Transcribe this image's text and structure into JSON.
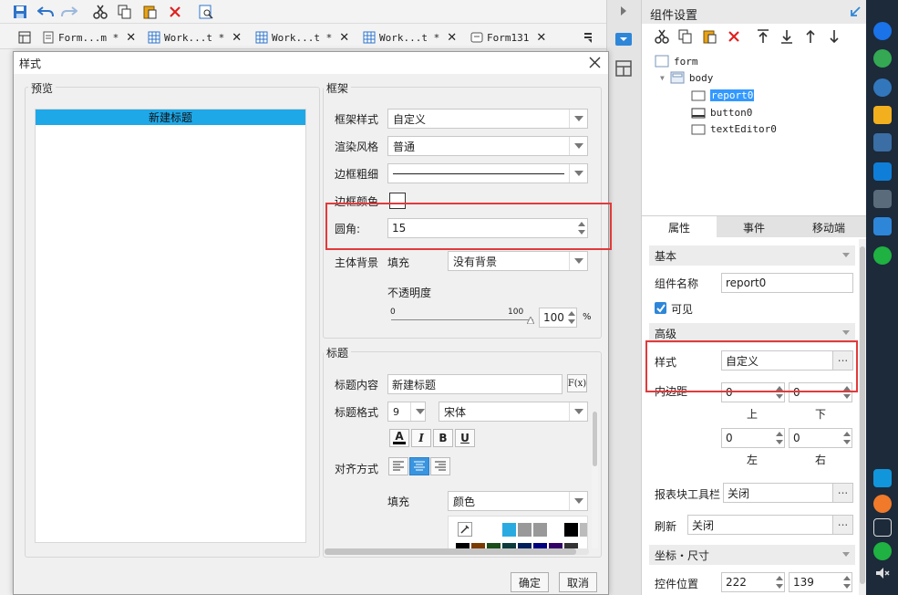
{
  "editor": {
    "tabs": [
      {
        "label": "Form...m *"
      },
      {
        "label": "Work...t *"
      },
      {
        "label": "Work...t *"
      },
      {
        "label": "Work...t *"
      },
      {
        "label": "Form131"
      }
    ]
  },
  "dialog": {
    "title": "样式",
    "preview": {
      "group_label": "预览",
      "header_text": "新建标题"
    },
    "frame": {
      "group_label": "框架",
      "frame_style_label": "框架样式",
      "frame_style_value": "自定义",
      "render_label": "渲染风格",
      "render_value": "普通",
      "border_width_label": "边框粗细",
      "border_color_label": "边框颜色",
      "radius_label": "圆角:",
      "radius_value": "15",
      "bg_label": "主体背景",
      "bg_fill_label": "填充",
      "bg_value": "没有背景",
      "opacity_label": "不透明度",
      "opacity_min": "0",
      "opacity_max": "100",
      "opacity_value": "100",
      "opacity_unit": "%"
    },
    "title_group": {
      "group_label": "标题",
      "content_label": "标题内容",
      "content_value": "新建标题",
      "fx_label": "F(x)",
      "format_label": "标题格式",
      "font_size": "9",
      "font_name": "宋体",
      "align_label": "对齐方式",
      "fill_label": "填充",
      "fill_value": "颜色",
      "bold_label": "B",
      "italic_label": "I",
      "underline_label": "U",
      "fontcolor_label": "A"
    },
    "ok_label": "确定",
    "cancel_label": "取消"
  },
  "right_panel": {
    "title": "组件设置",
    "tree": {
      "form": "form",
      "body": "body",
      "report": "report0",
      "button": "button0",
      "editor": "textEditor0"
    },
    "tabs": {
      "attr": "属性",
      "event": "事件",
      "mobile": "移动端"
    },
    "basic": {
      "section": "基本",
      "name_label": "组件名称",
      "name_value": "report0",
      "visible_label": "可见"
    },
    "advanced": {
      "section": "高级",
      "style_label": "样式",
      "style_value": "自定义",
      "padding_label": "内边距",
      "top_value": "0",
      "top_label": "上",
      "bottom_value": "0",
      "bottom_label": "下",
      "left_value": "0",
      "left_label": "左",
      "right_value": "0",
      "right_label": "右",
      "toolbar_label": "报表块工具栏",
      "toolbar_value": "关闭",
      "refresh_label": "刷新",
      "refresh_value": "关闭"
    },
    "coords": {
      "section": "坐标・尺寸",
      "pos_label": "控件位置",
      "x_value": "222",
      "y_value": "139"
    }
  },
  "colors": {
    "accent": "#1ea8e8",
    "selection": "#3399ff",
    "highlight_box": "#e23a3a",
    "swatches_top": [
      "#ffffff",
      "#29abe2",
      "#999999",
      "#999999",
      "#ffffff",
      "#000000",
      "#bbbbbb"
    ],
    "swatches_bottom": [
      "#000000",
      "#7a3b00",
      "#1b4d1b",
      "#0d3b3b",
      "#00205b",
      "#000080",
      "#330066",
      "#333333"
    ]
  }
}
